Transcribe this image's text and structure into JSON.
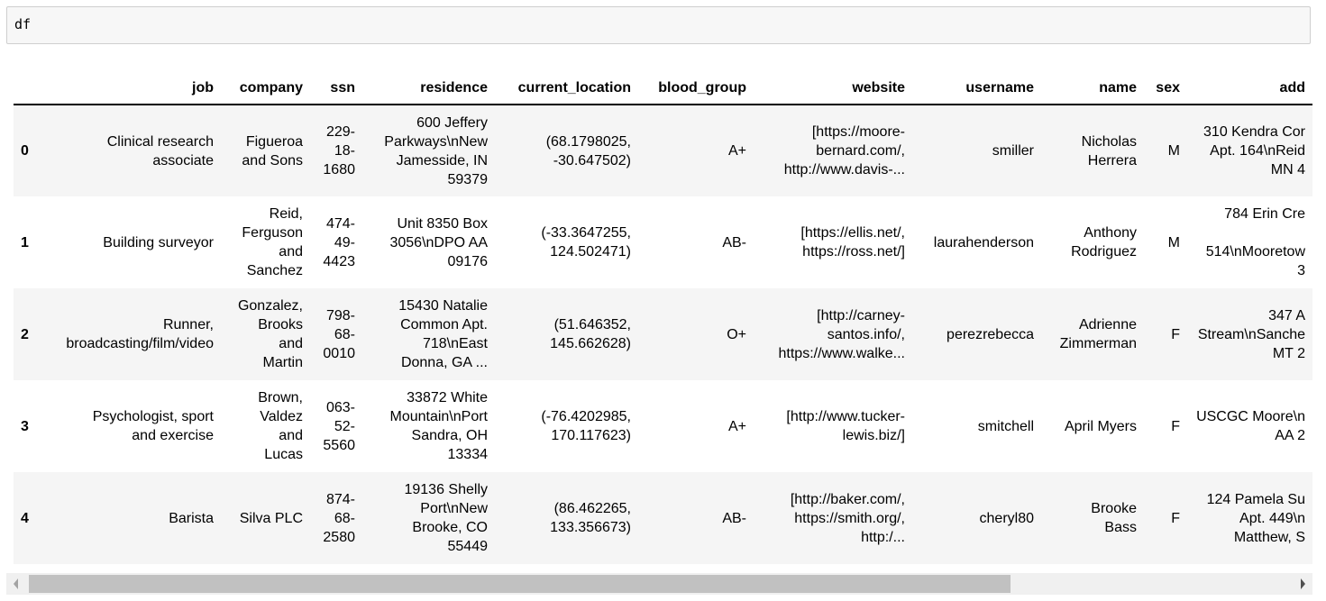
{
  "code_cell": {
    "source": "df"
  },
  "table": {
    "columns": [
      "",
      "job",
      "company",
      "ssn",
      "residence",
      "current_location",
      "blood_group",
      "website",
      "username",
      "name",
      "sex",
      "add"
    ],
    "rows": [
      {
        "index": "0",
        "cells": [
          [
            "Clinical research",
            "associate"
          ],
          [
            "Figueroa",
            "and Sons"
          ],
          [
            "229-",
            "18-",
            "1680"
          ],
          [
            "600 Jeffery",
            "Parkways\\nNew",
            "Jamesside, IN",
            "59379"
          ],
          [
            "(68.1798025,",
            "-30.647502)"
          ],
          [
            "A+"
          ],
          [
            "[https://moore-",
            "bernard.com/,",
            "http://www.davis-..."
          ],
          [
            "smiller"
          ],
          [
            "Nicholas",
            "Herrera"
          ],
          [
            "M"
          ],
          [
            "310 Kendra Cor",
            "Apt. 164\\nReid",
            "MN 4"
          ]
        ]
      },
      {
        "index": "1",
        "cells": [
          [
            "Building surveyor"
          ],
          [
            "Reid,",
            "Ferguson",
            "and",
            "Sanchez"
          ],
          [
            "474-",
            "49-",
            "4423"
          ],
          [
            "Unit 8350 Box",
            "3056\\nDPO AA",
            "09176"
          ],
          [
            "(-33.3647255,",
            "124.502471)"
          ],
          [
            "AB-"
          ],
          [
            "[https://ellis.net/,",
            "https://ross.net/]"
          ],
          [
            "laurahenderson"
          ],
          [
            "Anthony",
            "Rodriguez"
          ],
          [
            "M"
          ],
          [
            "784 Erin Cre",
            "",
            "514\\nMooretow",
            "3"
          ]
        ]
      },
      {
        "index": "2",
        "cells": [
          [
            "Runner,",
            "broadcasting/film/video"
          ],
          [
            "Gonzalez,",
            "Brooks",
            "and",
            "Martin"
          ],
          [
            "798-",
            "68-",
            "0010"
          ],
          [
            "15430 Natalie",
            "Common Apt.",
            "718\\nEast",
            "Donna, GA ..."
          ],
          [
            "(51.646352,",
            "145.662628)"
          ],
          [
            "O+"
          ],
          [
            "[http://carney-",
            "santos.info/,",
            "https://www.walke..."
          ],
          [
            "perezrebecca"
          ],
          [
            "Adrienne",
            "Zimmerman"
          ],
          [
            "F"
          ],
          [
            "347 A",
            "Stream\\nSanche",
            "MT 2"
          ]
        ]
      },
      {
        "index": "3",
        "cells": [
          [
            "Psychologist, sport",
            "and exercise"
          ],
          [
            "Brown,",
            "Valdez",
            "and",
            "Lucas"
          ],
          [
            "063-",
            "52-",
            "5560"
          ],
          [
            "33872 White",
            "Mountain\\nPort",
            "Sandra, OH",
            "13334"
          ],
          [
            "(-76.4202985,",
            "170.117623)"
          ],
          [
            "A+"
          ],
          [
            "[http://www.tucker-",
            "lewis.biz/]"
          ],
          [
            "smitchell"
          ],
          [
            "April Myers"
          ],
          [
            "F"
          ],
          [
            "USCGC Moore\\n",
            "AA 2"
          ]
        ]
      },
      {
        "index": "4",
        "cells": [
          [
            "Barista"
          ],
          [
            "Silva PLC"
          ],
          [
            "874-",
            "68-",
            "2580"
          ],
          [
            "19136 Shelly",
            "Port\\nNew",
            "Brooke, CO",
            "55449"
          ],
          [
            "(86.462265,",
            "133.356673)"
          ],
          [
            "AB-"
          ],
          [
            "[http://baker.com/,",
            "https://smith.org/,",
            "http:/..."
          ],
          [
            "cheryl80"
          ],
          [
            "Brooke",
            "Bass"
          ],
          [
            "F"
          ],
          [
            "124 Pamela Su",
            "Apt. 449\\n",
            "Matthew, S"
          ]
        ]
      }
    ]
  },
  "scrollbar": {
    "horizontal_position_percent": 0
  }
}
